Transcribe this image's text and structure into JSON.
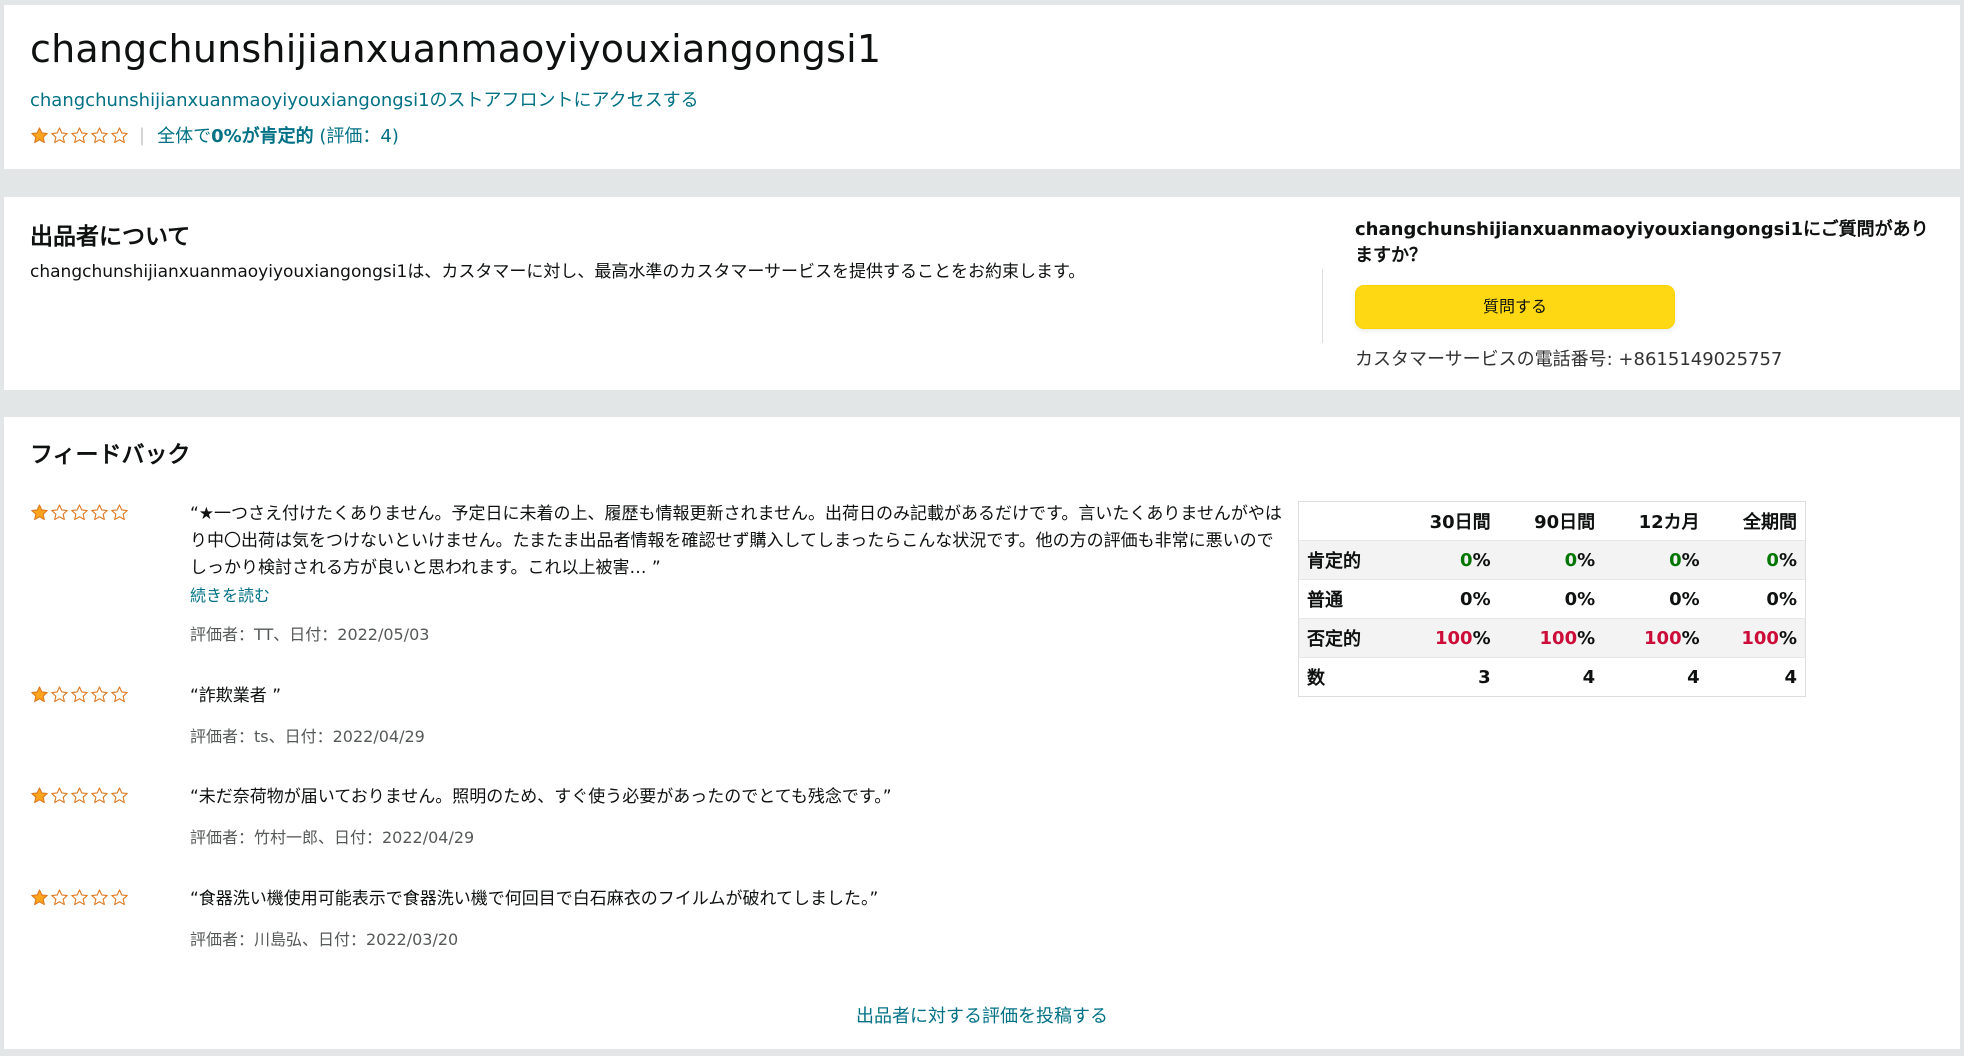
{
  "header": {
    "store_name": "changchunshijianxuanmaoyiyouxiangongsi1",
    "storefront_link": "changchunshijianxuanmaoyiyouxiangongsi1のストアフロントにアクセスする",
    "rating_stars": 1,
    "rating_prefix": "全体で",
    "rating_positive": "0%が肯定的",
    "rating_count": "(評価：4)"
  },
  "about": {
    "title": "出品者について",
    "description": "changchunshijianxuanmaoyiyouxiangongsi1は、カスタマーに対し、最高水準のカスタマーサービスを提供することをお約束します。",
    "ask_heading": "changchunshijianxuanmaoyiyouxiangongsi1にご質問がありますか？",
    "ask_button": "質問する",
    "phone": "カスタマーサービスの電話番号: +8615149025757"
  },
  "feedback": {
    "title": "フィードバック",
    "reviews": [
      {
        "stars": 1,
        "text": "“★一つさえ付けたくありません。予定日に未着の上、履歴も情報更新されません。出荷日のみ記載があるだけです。言いたくありませんがやはり中〇出荷は気をつけないといけません。たまたま出品者情報を確認せず購入してしまったらこんな状況です。他の方の評価も非常に悪いのでしっかり検討される方が良いと思われます。これ以上被害… ”",
        "read_more": "続きを読む",
        "meta": "評価者：TT、日付：2022/05/03"
      },
      {
        "stars": 1,
        "text": "“詐欺業者 ”",
        "meta": "評価者：ts、日付：2022/04/29"
      },
      {
        "stars": 1,
        "text": "“未だ奈荷物が届いておりません。照明のため、すぐ使う必要があったのでとても残念です。”",
        "meta": "評価者：竹村一郎、日付：2022/04/29"
      },
      {
        "stars": 1,
        "text": "“食器洗い機使用可能表示で食器洗い機で何回目で白石麻衣のフイルムが破れてしました。”",
        "meta": "評価者：川島弘、日付：2022/03/20"
      }
    ],
    "table": {
      "columns": [
        "",
        "30日間",
        "90日間",
        "12カ月",
        "全期間"
      ],
      "rows": [
        {
          "label": "肯定的",
          "values": [
            "0",
            "0",
            "0",
            "0"
          ],
          "unit": "%"
        },
        {
          "label": "普通",
          "values": [
            "0",
            "0",
            "0",
            "0"
          ],
          "unit": "%"
        },
        {
          "label": "否定的",
          "values": [
            "100",
            "100",
            "100",
            "100"
          ],
          "unit": "%"
        },
        {
          "label": "数",
          "values": [
            "3",
            "4",
            "4",
            "4"
          ],
          "unit": ""
        }
      ]
    },
    "leave_feedback": "出品者に対する評価を投稿する"
  },
  "colors": {
    "star_fill": "#ffa41c",
    "star_outline": "#de7921",
    "link": "#007185",
    "positive": "#007600",
    "negative": "#cc0c39",
    "button": "#ffd814"
  }
}
